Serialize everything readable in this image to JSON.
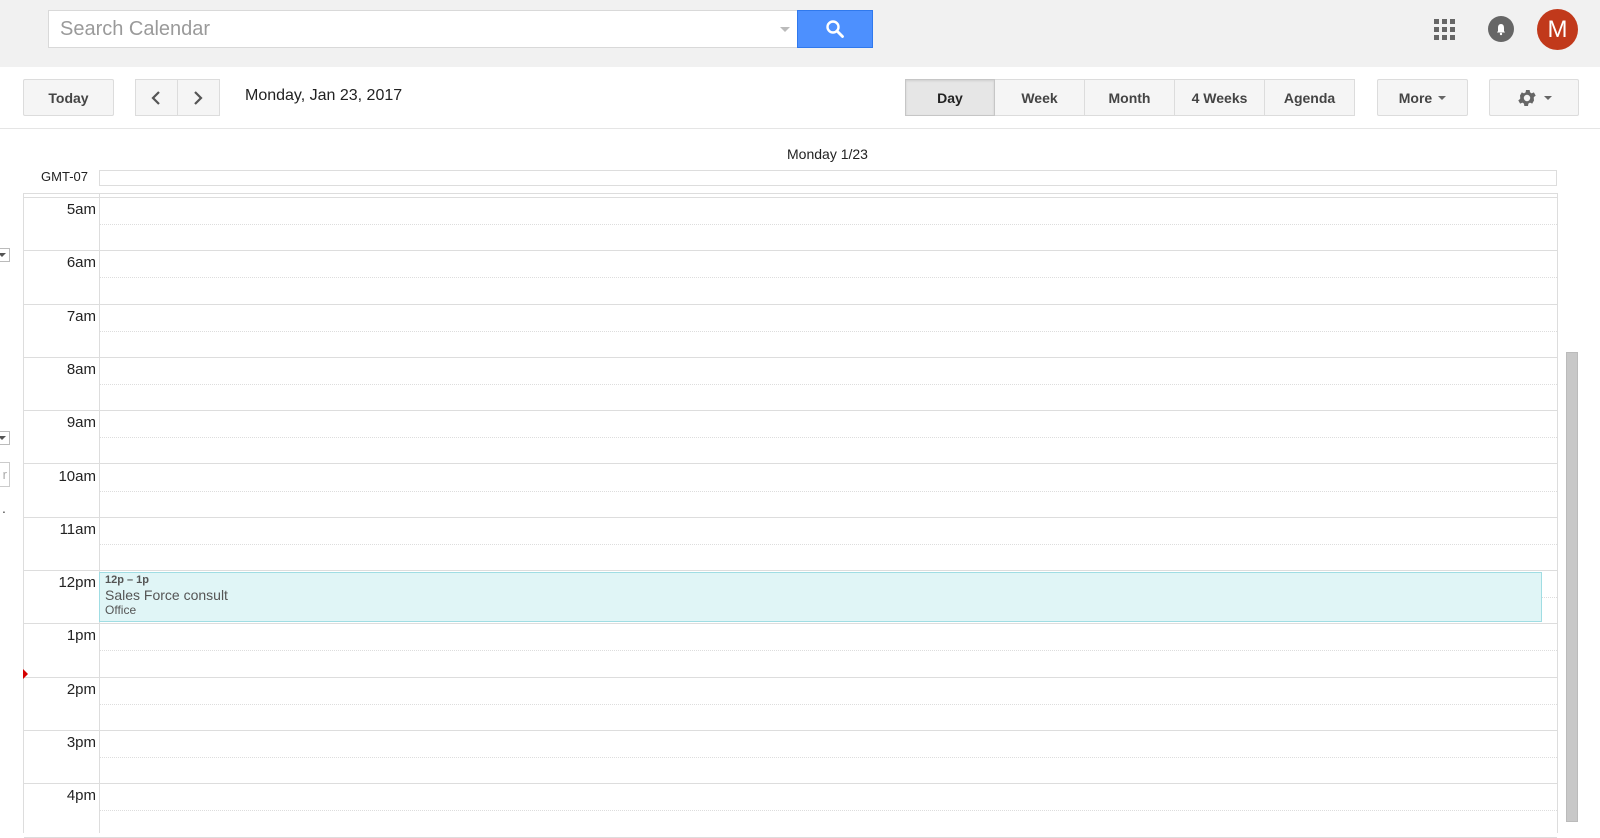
{
  "search": {
    "placeholder": "Search Calendar",
    "value": ""
  },
  "header_icons": {
    "apps": "apps-grid-icon",
    "notifications": "bell-icon",
    "avatar_initial": "M",
    "avatar_color": "#c1391b"
  },
  "toolbar": {
    "today_label": "Today",
    "prev_icon": "chevron-left-icon",
    "next_icon": "chevron-right-icon",
    "current_date": "Monday, Jan 23, 2017",
    "views": [
      {
        "label": "Day",
        "active": true
      },
      {
        "label": "Week",
        "active": false
      },
      {
        "label": "Month",
        "active": false
      },
      {
        "label": "4 Weeks",
        "active": false
      },
      {
        "label": "Agenda",
        "active": false
      }
    ],
    "more_label": "More",
    "settings_icon": "gear-icon"
  },
  "day_view": {
    "day_header": "Monday 1/23",
    "timezone": "GMT-07",
    "hours": [
      "5am",
      "6am",
      "7am",
      "8am",
      "9am",
      "10am",
      "11am",
      "12pm",
      "1pm",
      "2pm",
      "3pm",
      "4pm"
    ],
    "events": [
      {
        "time": "12p – 1p",
        "title": "Sales Force consult",
        "location": "Office",
        "color": "#e0f5f6",
        "border_color": "#a0dde3"
      }
    ]
  },
  "left_panel_partial": {
    "input_fragment": "r",
    "dot": "."
  },
  "colors": {
    "search_button": "#4d90fe",
    "now_marker": "#d50000",
    "topbar_bg": "#f1f1f1"
  }
}
